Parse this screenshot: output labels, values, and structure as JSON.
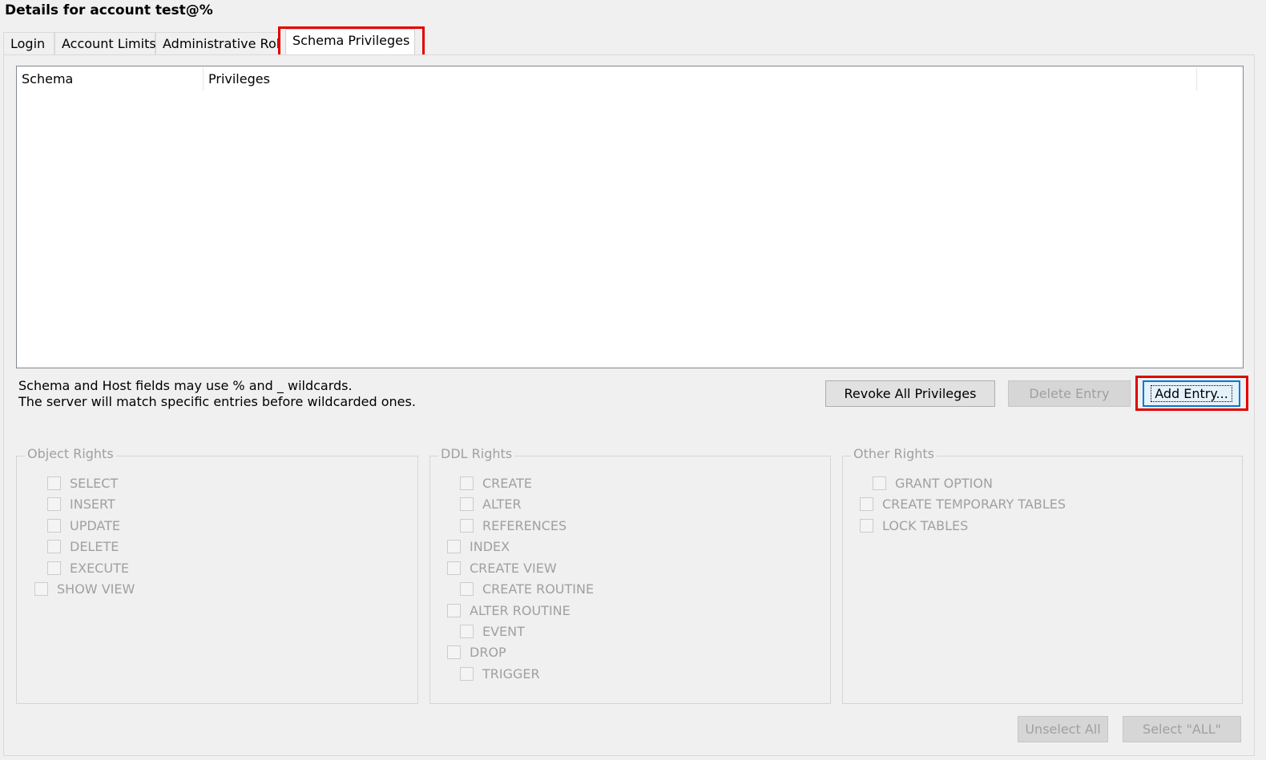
{
  "window": {
    "title": "Details for account test@%"
  },
  "tabs": [
    {
      "label": "Login"
    },
    {
      "label": "Account Limits"
    },
    {
      "label": "Administrative Roles"
    },
    {
      "label": "Schema Privileges"
    }
  ],
  "list": {
    "columns": [
      "Schema",
      "Privileges"
    ],
    "rows": []
  },
  "note": {
    "line1": "Schema and Host fields may use % and _ wildcards.",
    "line2": "The server will match specific entries before wildcarded ones."
  },
  "buttons": {
    "revoke_all": "Revoke All Privileges",
    "delete_entry": "Delete Entry",
    "add_entry": "Add Entry...",
    "unselect_all": "Unselect All",
    "select_all": "Select \"ALL\""
  },
  "groups": {
    "object_rights": {
      "title": "Object Rights",
      "items": [
        "SELECT",
        "INSERT",
        "UPDATE",
        "DELETE",
        "EXECUTE",
        "SHOW VIEW"
      ]
    },
    "ddl_rights": {
      "title": "DDL Rights",
      "items": [
        "CREATE",
        "ALTER",
        "REFERENCES",
        "INDEX",
        "CREATE VIEW",
        "CREATE ROUTINE",
        "ALTER ROUTINE",
        "EVENT",
        "DROP",
        "TRIGGER"
      ]
    },
    "other_rights": {
      "title": "Other Rights",
      "items": [
        "GRANT OPTION",
        "CREATE TEMPORARY TABLES",
        "LOCK TABLES"
      ]
    }
  },
  "colors": {
    "highlight": "#e00000",
    "disabled_text": "#a0a0a0"
  }
}
